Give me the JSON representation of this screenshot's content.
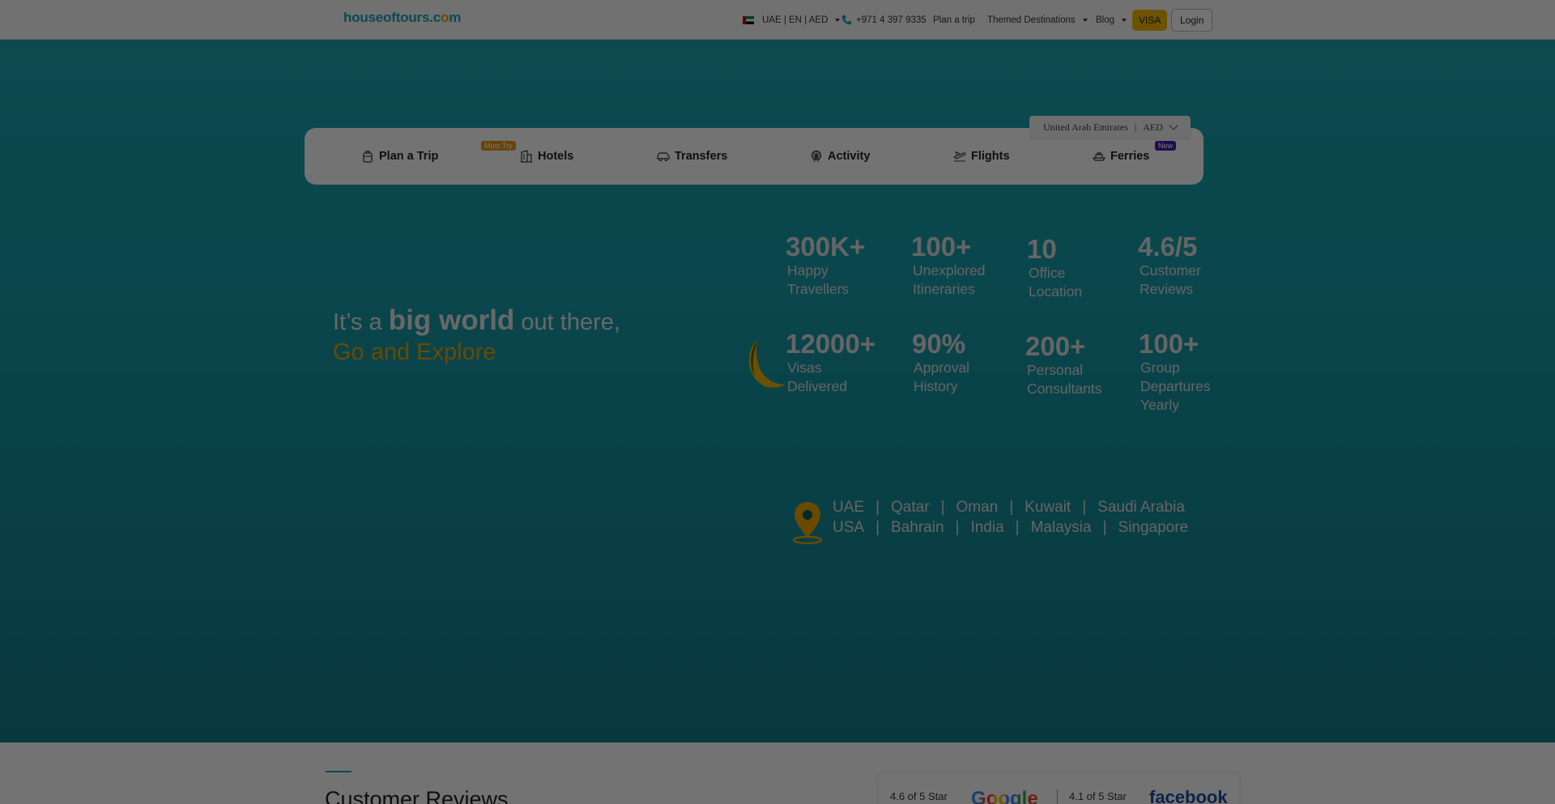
{
  "header": {
    "logo_main": "houseoftours.c",
    "logo_dot": "o",
    "logo_end": "m",
    "locale": "UAE | EN | AED",
    "phone": "+971 4 397 9335",
    "plan": "Plan a trip",
    "themed": "Themed Destinations",
    "blog": "Blog",
    "visa": "VISA",
    "login": "Login"
  },
  "search": {
    "region": "United Arab Emirates",
    "currency": "AED",
    "tabs": [
      {
        "label": "Plan a Trip",
        "badge": "Must Try"
      },
      {
        "label": "Hotels"
      },
      {
        "label": "Transfers"
      },
      {
        "label": "Activity"
      },
      {
        "label": "Flights"
      },
      {
        "label": "Ferries",
        "badge": "New"
      }
    ]
  },
  "hero": {
    "line1_a": "It’s a ",
    "line1_b": "big world",
    "line1_c": " out there,",
    "line2": "Go and Explore"
  },
  "stats": [
    {
      "num": "300K+",
      "l1": "Happy",
      "l2": "Travellers"
    },
    {
      "num": "100+",
      "l1": "Unexplored",
      "l2": "Itineraries"
    },
    {
      "num": "10",
      "l1": "Office",
      "l2": "Location"
    },
    {
      "num": "4.6/5",
      "l1": "Customer",
      "l2": "Reviews"
    },
    {
      "num": "12000+",
      "l1": "Visas",
      "l2": "Delivered"
    },
    {
      "num": "90%",
      "l1": "Approval",
      "l2": "History"
    },
    {
      "num": "200+",
      "l1": "Personal",
      "l2": "Consultants"
    },
    {
      "num": "100+",
      "l1": "Group",
      "l2": "Departures",
      "l3": "Yearly"
    }
  ],
  "locations": {
    "row1": [
      "UAE",
      "Qatar",
      "Oman",
      "Kuwait",
      "Saudi Arabia"
    ],
    "row2": [
      "USA",
      "Bahrain",
      "India",
      "Malaysia",
      "Singapore"
    ],
    "separator": "|"
  },
  "reviews": {
    "title": "Customer Reviews",
    "google_rating": "4.6 of 5 Star",
    "google": "Google",
    "fb_rating": "4.1 of 5 Star",
    "fb": "facebook"
  },
  "colors": {
    "brand": "#17a4b7",
    "accent": "#f3b60b",
    "explore": "#e8a400"
  }
}
